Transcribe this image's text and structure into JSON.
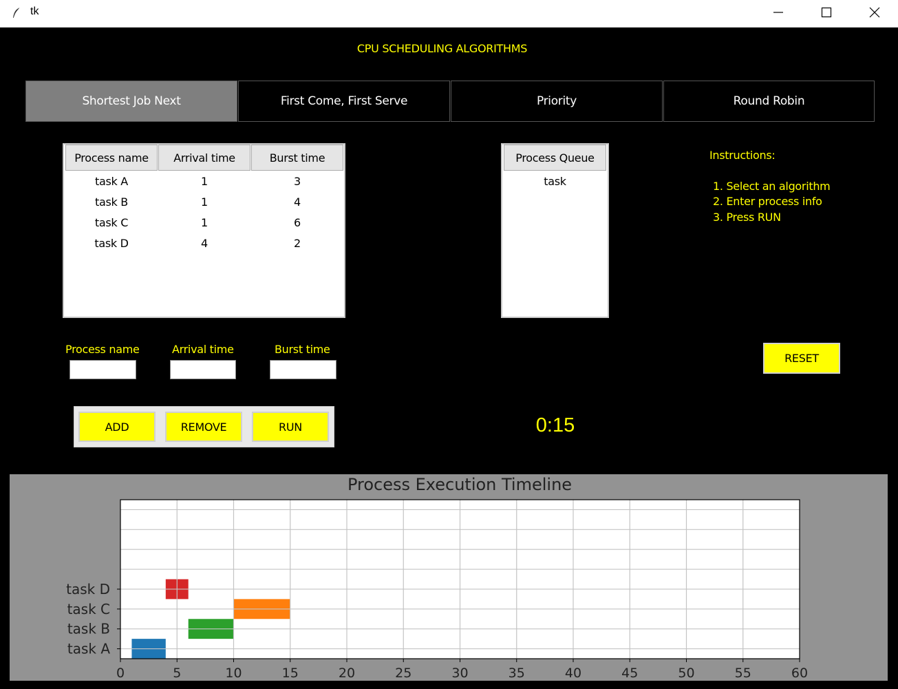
{
  "window": {
    "title": "tk"
  },
  "header": {
    "title": "CPU SCHEDULING ALGORITHMS"
  },
  "tabs": [
    {
      "label": "Shortest Job Next",
      "active": true
    },
    {
      "label": "First Come, First Serve",
      "active": false
    },
    {
      "label": "Priority",
      "active": false
    },
    {
      "label": "Round Robin",
      "active": false
    }
  ],
  "process_table": {
    "columns": [
      "Process name",
      "Arrival time",
      "Burst time"
    ],
    "rows": [
      [
        "task A",
        "1",
        "3"
      ],
      [
        "task B",
        "1",
        "4"
      ],
      [
        "task C",
        "1",
        "6"
      ],
      [
        "task D",
        "4",
        "2"
      ]
    ]
  },
  "queue": {
    "header": "Process Queue",
    "items": [
      "task"
    ]
  },
  "instructions": {
    "title": "Instructions:",
    "steps": [
      "1. Select an algorithm",
      "2. Enter process info",
      "3. Press RUN"
    ]
  },
  "inputs": {
    "process_name_label": "Process name",
    "arrival_label": "Arrival time",
    "burst_label": "Burst time",
    "process_name_value": "",
    "arrival_value": "",
    "burst_value": ""
  },
  "buttons": {
    "add": "ADD",
    "remove": "REMOVE",
    "run": "RUN",
    "reset": "RESET"
  },
  "timer": "0:15",
  "colors": {
    "accent": "#ffff00",
    "background": "#000000",
    "active_tab": "#7f7f7f"
  },
  "chart_data": {
    "type": "bar",
    "orientation": "horizontal-gantt",
    "title": "Process Execution Timeline",
    "xlabel": "",
    "ylabel": "",
    "xlim": [
      0,
      60
    ],
    "xticks": [
      0,
      5,
      10,
      15,
      20,
      25,
      30,
      35,
      40,
      45,
      50,
      55,
      60
    ],
    "categories": [
      "task A",
      "task B",
      "task C",
      "task D"
    ],
    "bars": [
      {
        "task": "task A",
        "start": 1,
        "end": 4,
        "color": "#1f77b4"
      },
      {
        "task": "task B",
        "start": 6,
        "end": 10,
        "color": "#2ca02c"
      },
      {
        "task": "task C",
        "start": 10,
        "end": 15,
        "color": "#ff7f0e"
      },
      {
        "task": "task D",
        "start": 4,
        "end": 6,
        "color": "#d62728"
      }
    ],
    "grid": true
  }
}
